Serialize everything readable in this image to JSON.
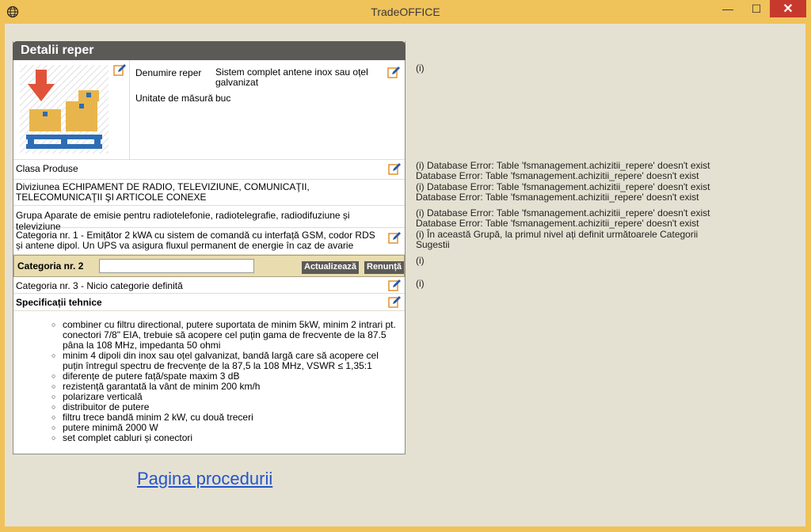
{
  "window": {
    "title": "TradeOFFICE",
    "minimize": "—",
    "maximize": "☐",
    "close": "✕"
  },
  "panel": {
    "title": "Detalii reper",
    "denumire_label": "Denumire reper",
    "denumire_value": "Sistem complet antene inox sau oțel galvanizat",
    "unitate_label": "Unitate de măsură",
    "unitate_value": "buc",
    "clasa": "Clasa Produse",
    "diviziunea": "Diviziunea ECHIPAMENT DE RADIO, TELEVIZIUNE, COMUNICAŢII, TELECOMUNICAŢII ŞI ARTICOLE CONEXE",
    "grupa": "Grupa Aparate de emisie pentru radiotelefonie, radiotelegrafie, radiodifuziune și televiziune",
    "categoria1": "Categoria nr. 1 -  Emițător 2 kWA cu sistem de comandă cu interfață GSM, codor RDS și antene dipol. Un UPS va asigura fluxul permanent de energie în caz de avarie",
    "categoria2_label": "Categoria nr. 2",
    "categoria2_input": "",
    "btn_update": "Actualizează",
    "btn_cancel": "Renunță",
    "categoria3": "Categoria nr. 3 -  Nicio categorie definită",
    "specs_title": "Specificații tehnice",
    "specs": [
      "combiner cu filtru directional, putere suportata de minim 5kW, minim 2 intrari pt. conectori 7/8\" EIA, trebuie să acopere cel puțin gama de frecvente de la 87.5 pâna la 108 MHz, impedanta 50 ohmi",
      "minim 4 dipoli din inox sau oțel galvanizat, bandă largă care să acopere cel puțin întregul spectru de frecvențe de la 87,5 la 108 MHz, VSWR ≤ 1,35:1",
      "diferențe de putere față/spate maxim 3 dB",
      "rezistență garantată la vânt de minim 200 km/h",
      "polarizare verticală",
      "distribuitor de putere",
      "filtru trece bandă minim 2 kW, cu două treceri",
      "putere minimă 2000 W",
      "set complet cabluri și conectori"
    ]
  },
  "link": "Pagina procedurii",
  "right": {
    "info1": "(i)",
    "block1_l1": "(i) Database Error: Table 'fsmanagement.achizitii_repere' doesn't exist",
    "block1_l2": "Database Error: Table 'fsmanagement.achizitii_repere' doesn't exist",
    "block1_l3": "(i) Database Error: Table 'fsmanagement.achizitii_repere' doesn't exist",
    "block1_l4": "Database Error: Table 'fsmanagement.achizitii_repere' doesn't exist",
    "block2_l1": "(i) Database Error: Table 'fsmanagement.achizitii_repere' doesn't exist",
    "block2_l2": "Database Error: Table 'fsmanagement.achizitii_repere' doesn't exist",
    "block2_l3": "(i) În această Grupă, la primul nivel ați definit următoarele Categorii",
    "block2_l4": "Sugestii",
    "info_cat2": "(i)",
    "info_cat3": "(i)"
  }
}
